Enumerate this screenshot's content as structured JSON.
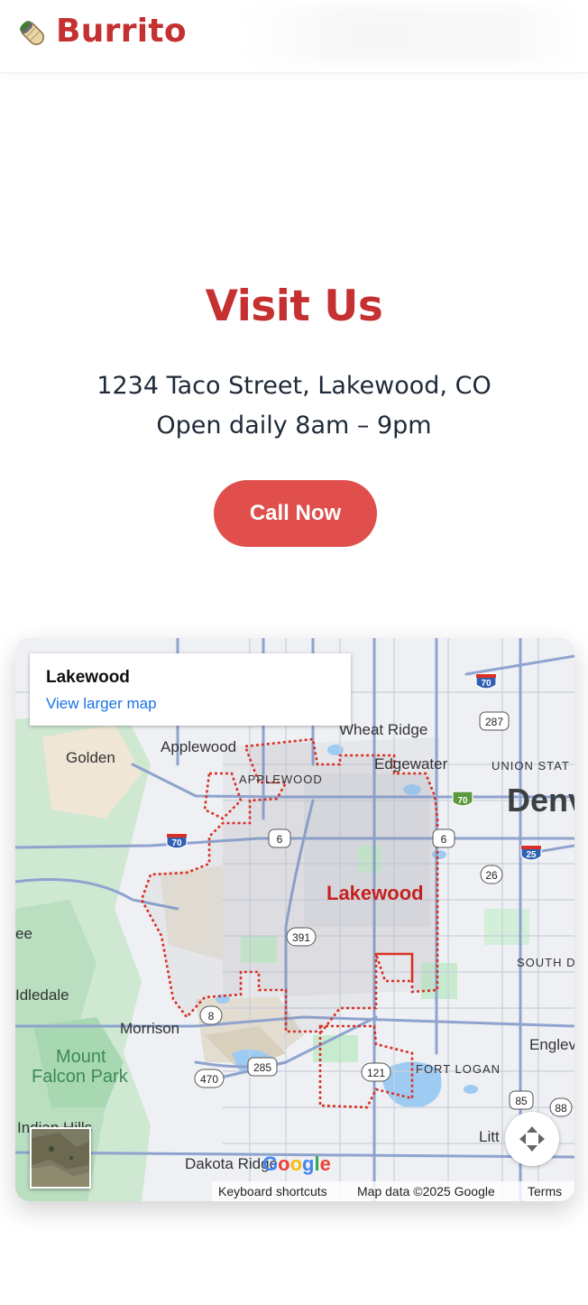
{
  "header": {
    "brand": "Burrito",
    "logo_icon": "burrito-icon"
  },
  "visit": {
    "title": "Visit Us",
    "address": "1234 Taco Street, Lakewood, CO",
    "hours": "Open daily 8am – 9pm",
    "call_button": "Call Now"
  },
  "map": {
    "place_name": "Lakewood",
    "view_larger": "View larger map",
    "labels": {
      "lakewood": "Lakewood",
      "wheat_ridge": "Wheat Ridge",
      "golden": "Golden",
      "applewood": "Applewood",
      "applewood_caps": "APPLEWOOD",
      "edgewater": "Edgewater",
      "union_station": "UNION STAT",
      "denver": "Denv",
      "south_d": "SOUTH D",
      "idledale": "Idledale",
      "morrison": "Morrison",
      "mount": "Mount",
      "falcon_park": "Falcon Park",
      "fort_logan": "FORT LOGAN",
      "englewood": "Englev",
      "indian_hills": "Indian Hills",
      "dakota_ridge": "Dakota Ridge",
      "littleton": "Litt",
      "edge_e": "ee"
    },
    "shields": {
      "i70_a": "70",
      "i70_b": "70",
      "i70_c": "70",
      "i25": "25",
      "us6_a": "6",
      "us6_b": "6",
      "us287": "287",
      "s26": "26",
      "s391": "391",
      "s8": "8",
      "s470": "470",
      "us285": "285",
      "s121": "121",
      "us85": "85",
      "s88": "88"
    },
    "google": "Google",
    "attribution": {
      "shortcuts": "Keyboard shortcuts",
      "map_data": "Map data ©2025 Google",
      "terms": "Terms"
    },
    "colors": {
      "boundary": "#d93025",
      "lakewood_label": "#c5221f",
      "water": "#9ecbf2",
      "park": "#c8ebd0"
    }
  }
}
